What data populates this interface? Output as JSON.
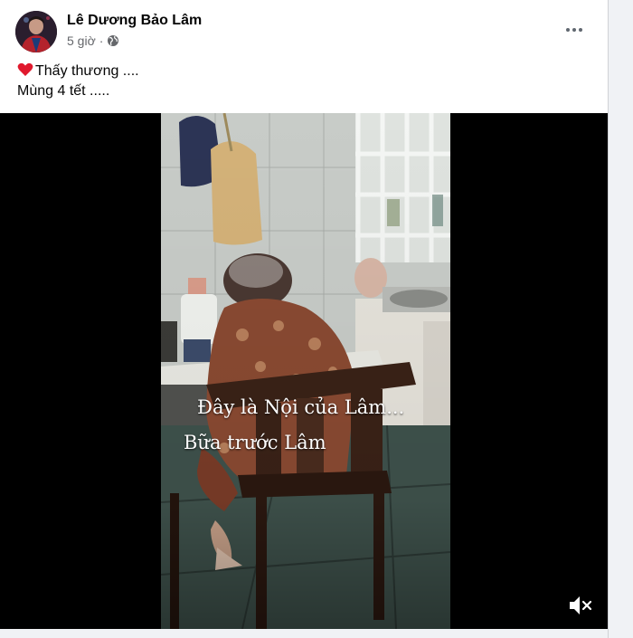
{
  "post": {
    "author": "Lê Dương Bảo Lâm",
    "time": "5 giờ",
    "separator": "·",
    "audience_icon": "globe-icon",
    "more_icon": "more-options-icon",
    "text_line1": "Thấy thương ....",
    "text_line2": "Mùng 4 tết .....",
    "emoji": "red-heart-icon"
  },
  "video": {
    "caption_line1": "Đây là Nội của Lâm...",
    "caption_line2": "Bữa trước Lâm",
    "mute_icon": "muted-speaker-icon"
  }
}
